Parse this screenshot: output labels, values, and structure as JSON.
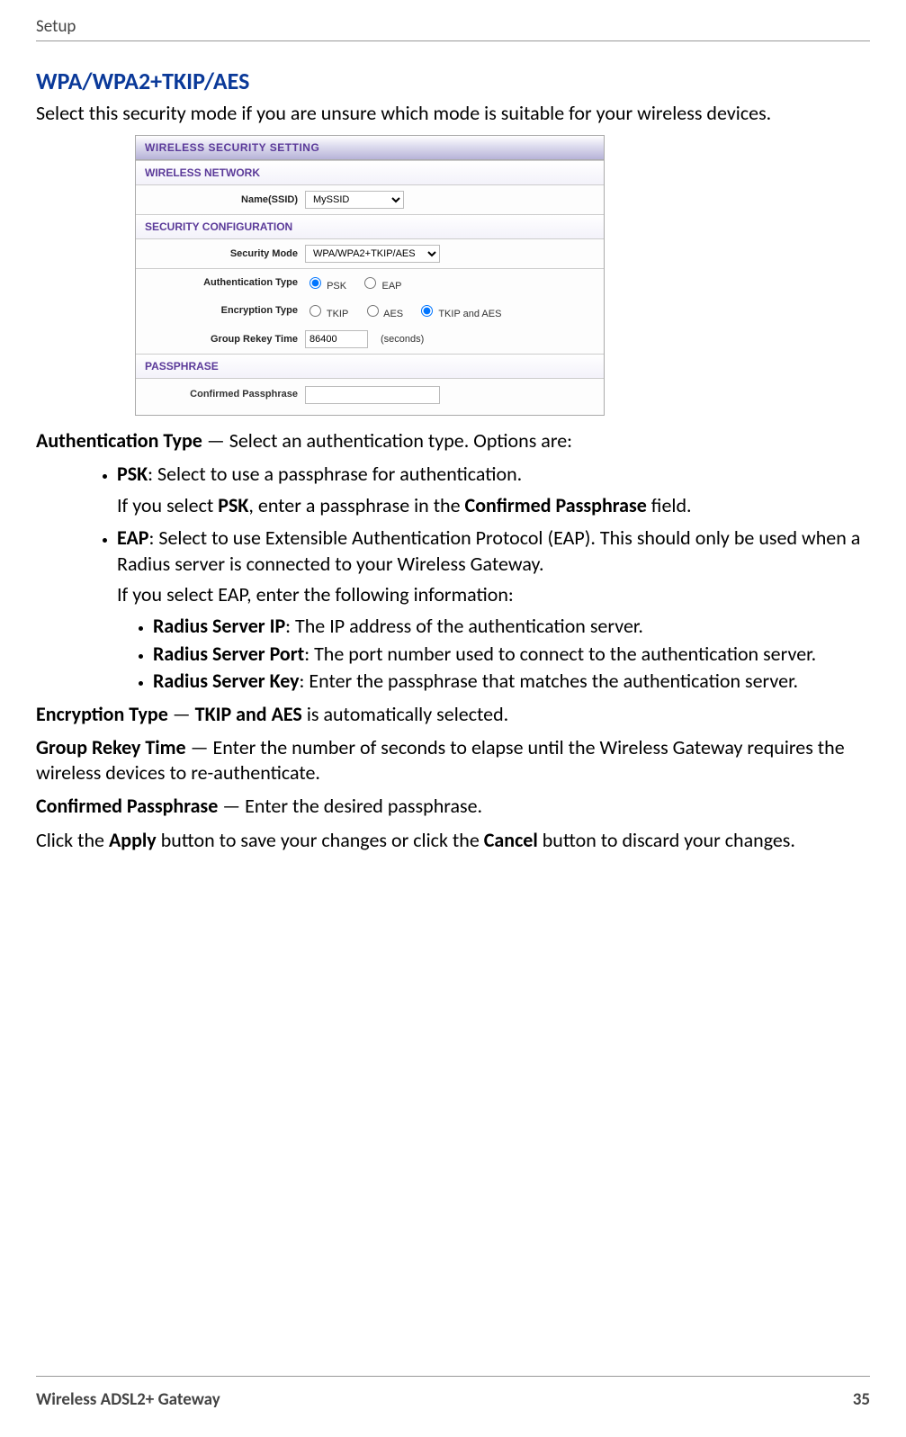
{
  "header": {
    "title": "Setup"
  },
  "section": {
    "heading": "WPA/WPA2+TKIP/AES",
    "intro": "Select this security mode if you are unsure which mode is suitable for your wireless devices."
  },
  "panel": {
    "title": "WIRELESS SECURITY SETTING",
    "wn_header": "WIRELESS NETWORK",
    "ssid_label": "Name(SSID)",
    "ssid_value": "MySSID",
    "sc_header": "SECURITY CONFIGURATION",
    "mode_label": "Security Mode",
    "mode_value": "WPA/WPA2+TKIP/AES",
    "auth_label": "Authentication Type",
    "auth_psk": "PSK",
    "auth_eap": "EAP",
    "enc_label": "Encryption Type",
    "enc_tkip": "TKIP",
    "enc_aes": "AES",
    "enc_both": "TKIP and AES",
    "rekey_label": "Group Rekey Time",
    "rekey_value": "86400",
    "rekey_unit": "(seconds)",
    "pp_header": "PASSPHRASE",
    "pp_label": "Confirmed Passphrase",
    "pp_value": ""
  },
  "desc": {
    "auth_lead": "Authentication Type",
    "auth_tail": " — Select an authentication type. Options are:",
    "psk_b": "PSK",
    "psk_t": ": Select to use a passphrase for authentication.",
    "psk_n1": "If you select ",
    "psk_nb": "PSK",
    "psk_n2": ", enter a passphrase in the ",
    "psk_nb2": "Confirmed Passphrase",
    "psk_n3": " field.",
    "eap_b": "EAP",
    "eap_t": ": Select to use Extensible Authentication Protocol (EAP). This should only be used when a Radius server is connected to your Wireless Gateway.",
    "eap_sub": "If you select EAP, enter the following information:",
    "rip_b": "Radius Server IP",
    "rip_t": ": The IP address of the authentication server.",
    "rport_b": "Radius Server Port",
    "rport_t": ": The port number used to connect to the authentication server.",
    "rkey_b": "Radius Server Key",
    "rkey_t": ": Enter the passphrase that matches the authentication server.",
    "enc_lead": "Encryption Type",
    "enc_mid": " — ",
    "enc_b2": "TKIP and AES",
    "enc_tail": " is automatically selected.",
    "grk_lead": "Group Rekey Time",
    "grk_tail": " — Enter the number of seconds to elapse until the Wireless Gateway requires the wireless devices to re-authenticate.",
    "cp_lead": "Confirmed Passphrase",
    "cp_tail": " — Enter the desired passphrase.",
    "apply1": "Click the ",
    "apply_b": "Apply",
    "apply2": " button to save your changes or click the ",
    "cancel_b": "Cancel",
    "apply3": " button to discard your changes."
  },
  "footer": {
    "product": "Wireless ADSL2+ Gateway",
    "page": "35"
  }
}
